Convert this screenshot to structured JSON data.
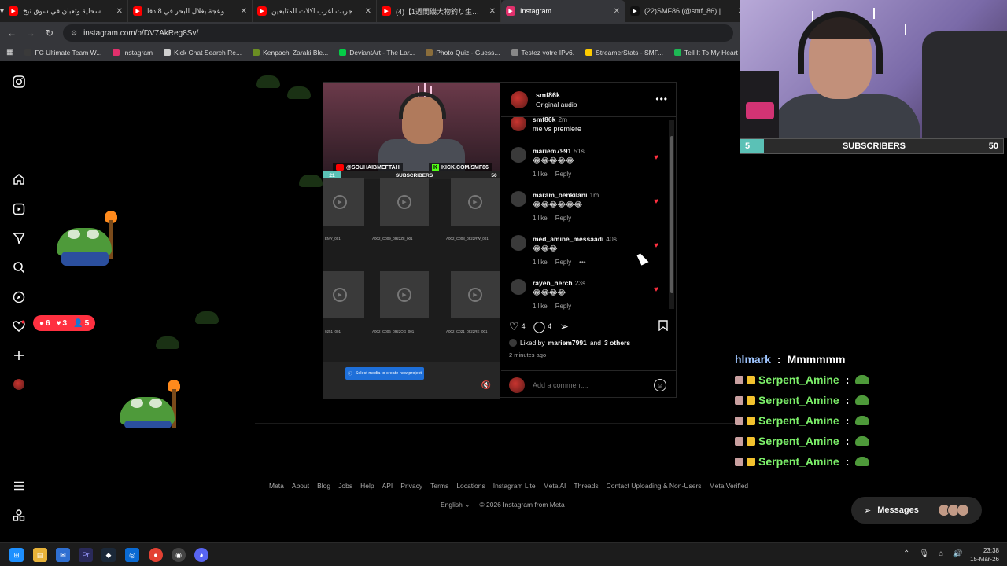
{
  "browser": {
    "tabs": [
      {
        "title": "أكلت سحلية وثعبان في سوق تبخ",
        "favicon_color": "#ff0000",
        "active": false
      },
      {
        "title": "مقرونة وعجة بغلال البحر في 8 دقا",
        "favicon_color": "#ff0000",
        "active": false
      },
      {
        "title": "جربت اغرب اكلات المتابعين - be",
        "favicon_color": "#ff0000",
        "active": false
      },
      {
        "title": "(4)【1週間磯大物釣り生活】大型",
        "favicon_color": "#ff0000",
        "active": false
      },
      {
        "title": "Instagram",
        "favicon_color": "#e1306c",
        "active": true
      },
      {
        "title": "(22)SMF86 (@smf_86) | TikTok",
        "favicon_color": "#111111",
        "active": false
      }
    ],
    "url": "instagram.com/p/DV7AkReg8Sv/",
    "bookmarks": [
      {
        "label": "FC Ultimate Team W...",
        "color": "#3a3a3a"
      },
      {
        "label": "Instagram",
        "color": "#e1306c"
      },
      {
        "label": "Kick Chat Search Re...",
        "color": "#cfcfcf"
      },
      {
        "label": "Kenpachi Zaraki Ble...",
        "color": "#6b8e23"
      },
      {
        "label": "DeviantArt - The Lar...",
        "color": "#05cc47"
      },
      {
        "label": "Photo Quiz - Guess...",
        "color": "#8a6d3b"
      },
      {
        "label": "Testez votre IPv6.",
        "color": "#888888"
      },
      {
        "label": "StreamerStats - SMF...",
        "color": "#ffcc00"
      },
      {
        "label": "Tell It To My Heart -...",
        "color": "#1db954"
      },
      {
        "label": "Globa",
        "color": "#d32f2f"
      }
    ]
  },
  "notifications": {
    "comments": "6",
    "likes": "3",
    "follows": "5"
  },
  "media": {
    "youtube_handle": "@SOUHAIBMEFTAH",
    "kick_handle": "KICK.COM/SMF86",
    "subs_label": "SUBSCRIBERS",
    "subs_count": "21",
    "subs_goal": "50",
    "tile_captions": [
      "EMY_001",
      "A002_C009_0922Z8_001",
      "A002_C008_0922RW_001",
      "0251_001",
      "A002_C006_0922OG_001",
      "A002_C021_0922RE_001"
    ],
    "select_button": "Select media to create new project"
  },
  "post": {
    "username": "smf86k",
    "audio": "Original audio",
    "caption": {
      "user": "smf86k",
      "time": "2m",
      "text": "me vs premiere"
    },
    "comments": [
      {
        "user": "mariem7991",
        "time": "51s",
        "text": "😂😂😂😂😂",
        "likes": "1 like",
        "reply": "Reply"
      },
      {
        "user": "maram_benkilani",
        "time": "1m",
        "text": "😂😂😂😂😂😂",
        "likes": "1 like",
        "reply": "Reply"
      },
      {
        "user": "med_amine_messaadi",
        "time": "40s",
        "text": "😂😂😂",
        "likes": "1 like",
        "reply": "Reply"
      },
      {
        "user": "rayen_herch",
        "time": "23s",
        "text": "😂😂😂😂",
        "likes": "1 like",
        "reply": "Reply"
      }
    ],
    "like_count": "4",
    "comment_count": "4",
    "liked_by_prefix": "Liked by",
    "liked_by_user": "mariem7991",
    "liked_by_and": "and",
    "liked_by_others": "3 others",
    "posted_ago": "2 minutes ago",
    "add_comment_placeholder": "Add a comment..."
  },
  "footer": {
    "links": [
      "Meta",
      "About",
      "Blog",
      "Jobs",
      "Help",
      "API",
      "Privacy",
      "Terms",
      "Locations",
      "Instagram Lite",
      "Meta AI",
      "Threads",
      "Contact Uploading & Non-Users",
      "Meta Verified"
    ],
    "language": "English",
    "copyright": "© 2026 Instagram from Meta"
  },
  "messages_button": "Messages",
  "overlay": {
    "subs_current": "5",
    "subs_label": "SUBSCRIBERS",
    "subs_goal": "50",
    "chat": [
      {
        "user": "hlmark",
        "message": "Mmmmmm",
        "emote": false,
        "badges": false
      },
      {
        "user": "Serpent_Amine",
        "message": "",
        "emote": true,
        "badges": true
      },
      {
        "user": "Serpent_Amine",
        "message": "",
        "emote": true,
        "badges": true
      },
      {
        "user": "Serpent_Amine",
        "message": "",
        "emote": true,
        "badges": true
      },
      {
        "user": "Serpent_Amine",
        "message": "",
        "emote": true,
        "badges": true
      },
      {
        "user": "Serpent_Amine",
        "message": "",
        "emote": true,
        "badges": true
      }
    ]
  },
  "taskbar": {
    "time": "23:38",
    "date": "15-Mar-26"
  }
}
